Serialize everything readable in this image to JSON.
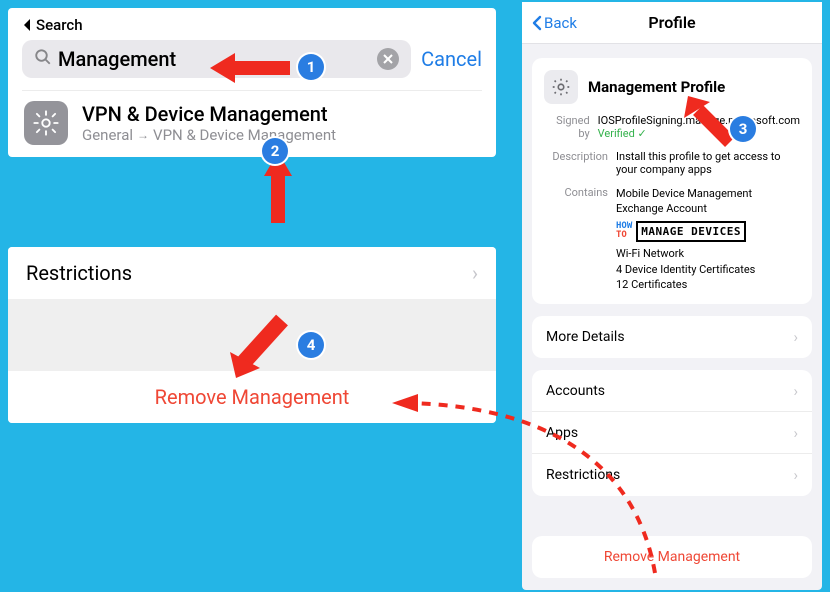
{
  "panel1": {
    "back_label": "Search",
    "search_value": "Management",
    "cancel_label": "Cancel",
    "result": {
      "title": "VPN & Device Management",
      "path_a": "General",
      "path_b": "VPN & Device Management"
    }
  },
  "panel2": {
    "restrictions_label": "Restrictions",
    "remove_label": "Remove Management"
  },
  "phone": {
    "back_label": "Back",
    "title": "Profile",
    "profile_name": "Management Profile",
    "signed_by_label": "Signed by",
    "signed_by_value": "IOSProfileSigning.manage.microsoft.com",
    "verified_label": "Verified",
    "description_label": "Description",
    "description_value": "Install this profile to get access to your company apps",
    "contains_label": "Contains",
    "contains_lines": {
      "l1": "Mobile Device Management",
      "l2": "Exchange Account",
      "l3": "Wi-Fi Network",
      "l4": "4 Device Identity Certificates",
      "l5": "12 Certificates"
    },
    "brand_how": "HOW",
    "brand_to": "TO",
    "brand_box": "MANAGE DEVICES",
    "more_details_label": "More Details",
    "rows": {
      "accounts": "Accounts",
      "apps": "Apps",
      "restrictions": "Restrictions"
    },
    "remove_label": "Remove Management"
  },
  "badges": {
    "b1": "1",
    "b2": "2",
    "b3": "3",
    "b4": "4"
  }
}
